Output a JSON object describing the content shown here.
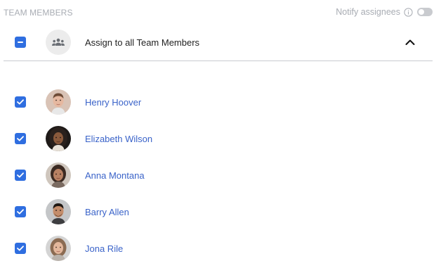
{
  "header": {
    "title": "TEAM MEMBERS",
    "notify_label": "Notify assignees",
    "notify_enabled": false
  },
  "assign_all": {
    "label": "Assign to all Team Members",
    "state": "indeterminate",
    "group_icon": "group-icon",
    "expand_icon": "chevron-up-icon"
  },
  "members": [
    {
      "name": "Henry Hoover",
      "checked": true
    },
    {
      "name": "Elizabeth Wilson",
      "checked": true
    },
    {
      "name": "Anna Montana",
      "checked": true
    },
    {
      "name": "Barry Allen",
      "checked": true
    },
    {
      "name": "Jona Rile",
      "checked": true
    }
  ],
  "colors": {
    "accent": "#2f6ee0",
    "link": "#3a63c9",
    "muted": "#a8acb3"
  }
}
